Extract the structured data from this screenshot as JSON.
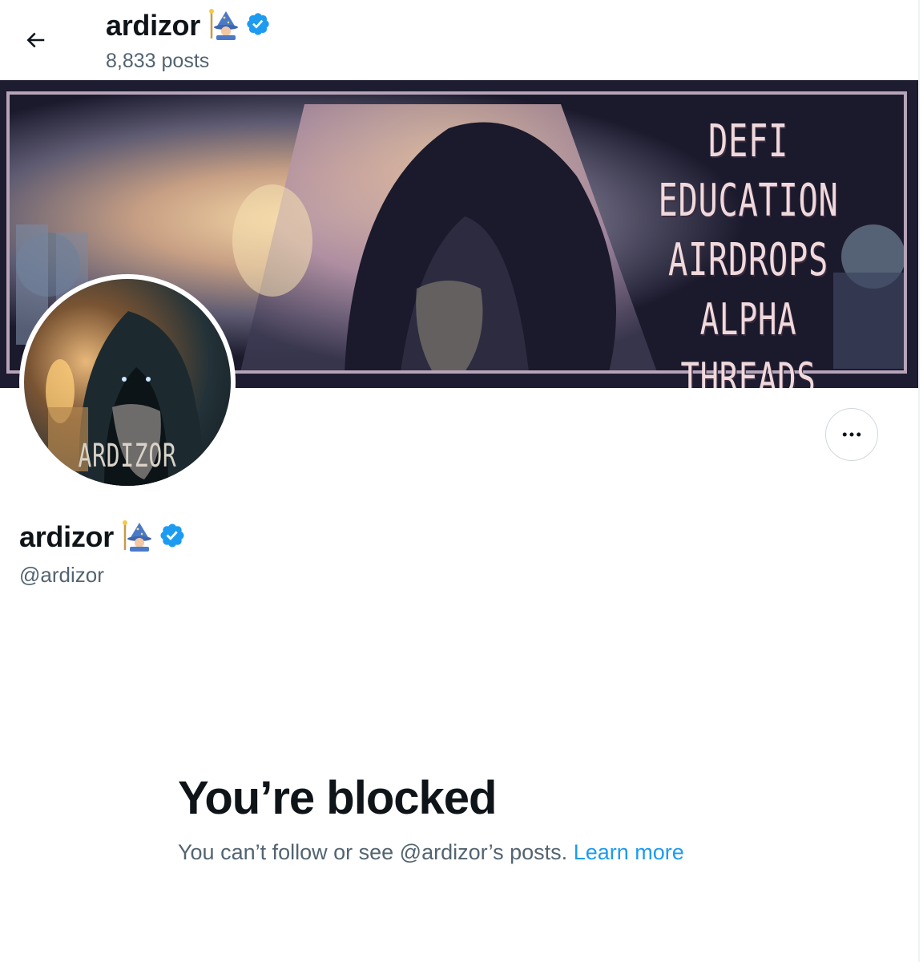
{
  "header": {
    "back_icon": "arrow-left-icon",
    "name": "ardizor",
    "name_emoji": "🧙‍♂️",
    "posts_count": "8,833 posts"
  },
  "banner": {
    "lines": [
      "DEFI",
      "EDUCATION",
      "AIRDROPS",
      "ALPHA THREADS"
    ]
  },
  "avatar": {
    "label": "ARDIZOR"
  },
  "actions": {
    "more_icon": "more-horizontal-icon"
  },
  "profile": {
    "name": "ardizor",
    "name_emoji": "🧙‍♂️",
    "handle": "@ardizor",
    "verified_icon": "verified-badge-icon"
  },
  "blocked": {
    "title": "You’re blocked",
    "message": "You can’t follow or see @ardizor’s posts.",
    "link": "Learn more"
  },
  "colors": {
    "accent": "#1d9bf0",
    "text_primary": "#0f1419",
    "text_secondary": "#536471",
    "border": "#cfd9de",
    "verified": "#1d9bf0"
  }
}
